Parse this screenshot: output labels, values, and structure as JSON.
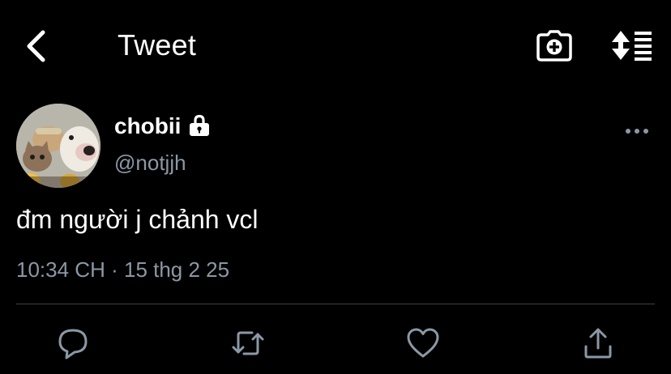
{
  "header": {
    "title": "Tweet",
    "icons": {
      "back": "chevron-left-icon",
      "camera": "camera-plus-icon",
      "sort": "sort-updown-icon"
    }
  },
  "author": {
    "display_name": "chobii",
    "handle": "@notjjh",
    "protected_icon": "lock-icon",
    "more_icon": "more-horizontal-icon"
  },
  "tweet": {
    "text": "đm người j chảnh vcl",
    "time": "10:34 CH",
    "separator": "·",
    "date": "15 thg 2 25"
  },
  "actions": [
    {
      "name": "reply",
      "icon": "reply-icon"
    },
    {
      "name": "retweet",
      "icon": "retweet-icon"
    },
    {
      "name": "like",
      "icon": "heart-icon"
    },
    {
      "name": "share",
      "icon": "share-icon"
    }
  ],
  "colors": {
    "background": "#000000",
    "text": "#ffffff",
    "secondary_text": "#8b98a5",
    "divider": "#38444d",
    "action_icon": "#8b98a5"
  }
}
